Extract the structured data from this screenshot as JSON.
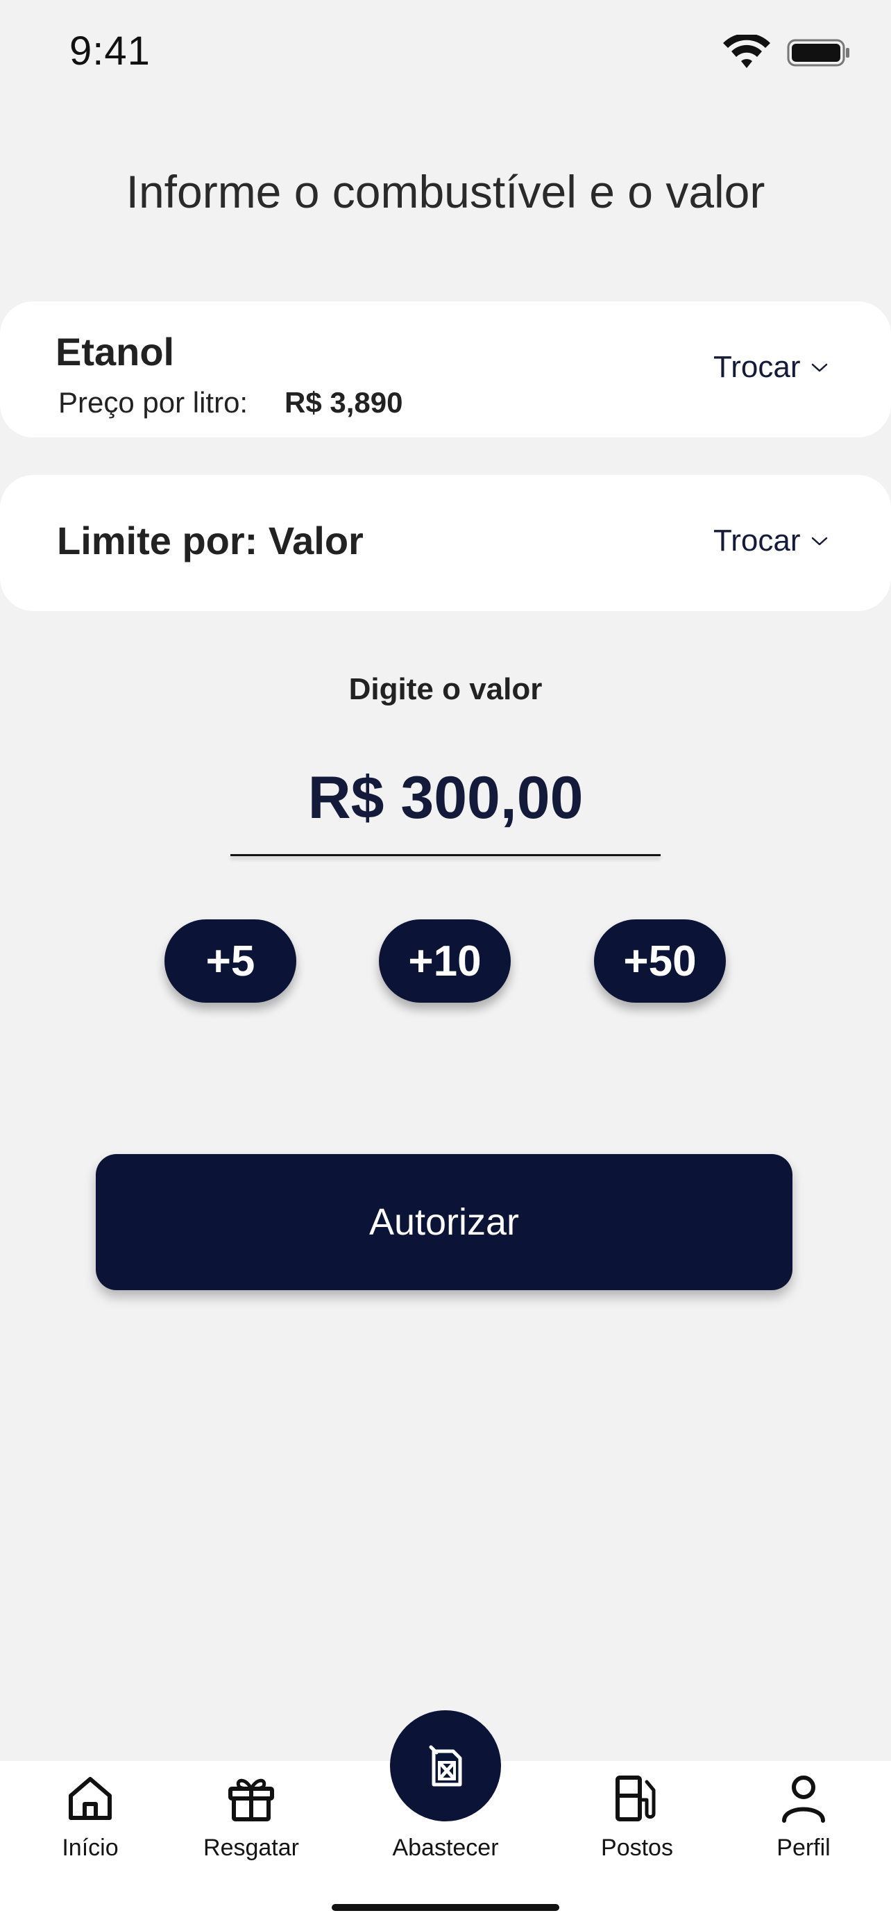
{
  "status_bar": {
    "time": "9:41"
  },
  "page": {
    "title": "Informe o combustível e o valor"
  },
  "fuel_card": {
    "name": "Etanol",
    "price_label": "Preço por litro:",
    "price_value": "R$ 3,890",
    "change_label": "Trocar"
  },
  "limit_card": {
    "label": "Limite por: Valor",
    "change_label": "Trocar"
  },
  "amount": {
    "label": "Digite o valor",
    "value": "R$ 300,00"
  },
  "quick_add": {
    "plus5": "+5",
    "plus10": "+10",
    "plus50": "+50"
  },
  "authorize_label": "Autorizar",
  "tabbar": {
    "inicio": "Início",
    "resgatar": "Resgatar",
    "abastecer": "Abastecer",
    "postos": "Postos",
    "perfil": "Perfil"
  },
  "colors": {
    "primary": "#0B1437",
    "background": "#F2F2F2",
    "card": "#FFFFFF"
  },
  "icons": {
    "inicio": "home-icon",
    "resgatar": "gift-icon",
    "abastecer": "fuel-can-icon",
    "postos": "gas-station-icon",
    "perfil": "user-icon"
  }
}
